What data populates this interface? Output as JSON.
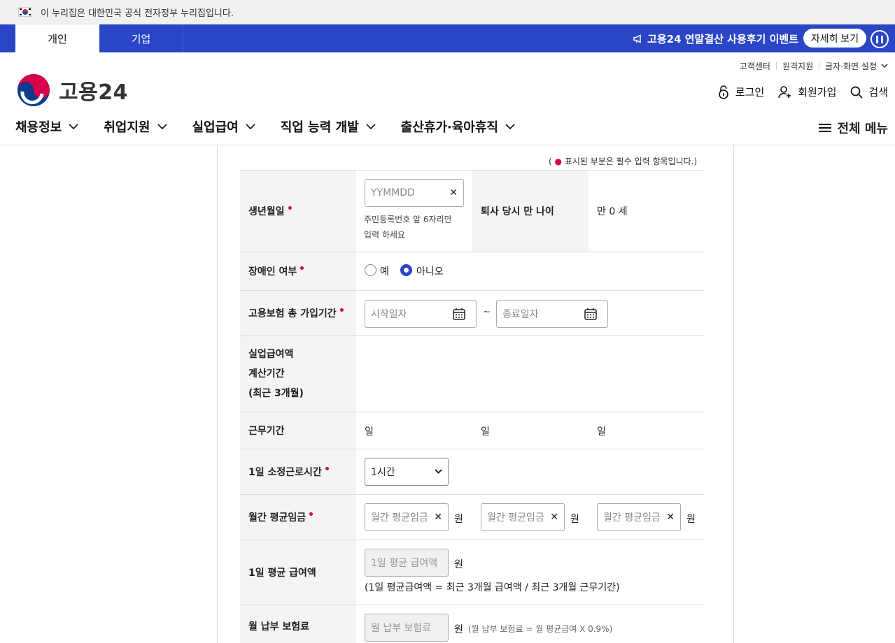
{
  "gov_banner": {
    "text": "이 누리집은 대한민국 공식 전자정부 누리집입니다."
  },
  "topbar": {
    "tabs": [
      "개인",
      "기업"
    ],
    "event_text": "고용24 연말결산 사용후기 이벤트",
    "event_button": "자세히 보기",
    "colors": {
      "bar": "#2a45c6"
    }
  },
  "header": {
    "logo_text": "고용24",
    "util_links": [
      "고객센터",
      "원격지원",
      "글자·화면 설정"
    ],
    "auth": {
      "login": "로그인",
      "signup": "회원가입",
      "search": "검색"
    }
  },
  "nav": {
    "items": [
      "채용정보",
      "취업지원",
      "실업급여",
      "직업 능력 개발",
      "출산휴가·육아휴직"
    ],
    "all_menu": "전체 메뉴"
  },
  "form": {
    "required_note": "표시된 부분은 필수 입력 항목입니다.",
    "birth": {
      "label": "생년월일",
      "placeholder": "YYMMDD",
      "help_line1": "주민등록번호 앞 6자리만",
      "help_line2": "입력 하세요",
      "age_label": "퇴사 당시 만 나이",
      "age_value": "만 0 세"
    },
    "disabled": {
      "label": "장애인 여부",
      "options": [
        "예",
        "아니오"
      ],
      "selected": "아니오"
    },
    "insurance_period": {
      "label": "고용보험 총 가입기간",
      "start_placeholder": "시작일자",
      "end_placeholder": "종료일자",
      "tilde": "~"
    },
    "calc_period": {
      "label_lines": [
        "실업급여액",
        "계산기간",
        "(최근 3개월)"
      ]
    },
    "work_days": {
      "label": "근무기간",
      "values": [
        "일",
        "일",
        "일"
      ]
    },
    "daily_hours": {
      "label": "1일 소정근로시간",
      "selected": "1시간"
    },
    "monthly_wage": {
      "label": "월간 평균임금",
      "placeholder": "월간 평균임금",
      "unit": "원"
    },
    "daily_pay": {
      "label": "1일 평균 급여액",
      "placeholder": "1일 평균 급여액",
      "unit": "원",
      "formula": "(1일 평균급여액 = 최근 3개월 급여액 / 최근 3개월 근무기간)"
    },
    "monthly_premium": {
      "label": "월 납부 보험료",
      "placeholder": "월 납부 보험료",
      "unit": "원",
      "formula": "(월 납부 보험료 = 월 평균급여 X 0.9%)"
    }
  }
}
